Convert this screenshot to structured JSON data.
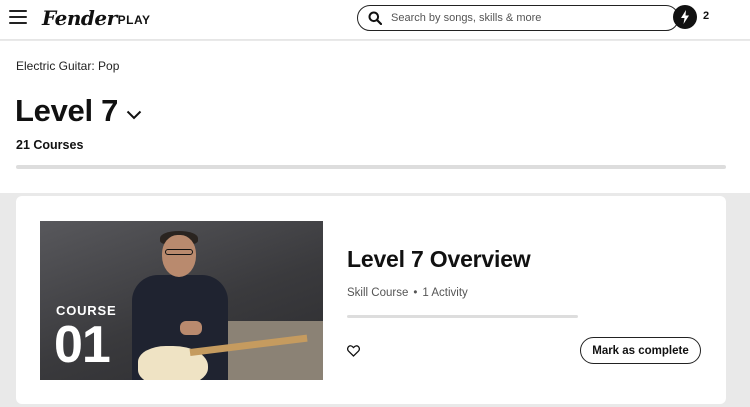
{
  "header": {
    "logo_text": "Fender",
    "logo_suffix": "PLAY",
    "search": {
      "placeholder": "Search by songs, skills & more",
      "icon": "search-icon"
    },
    "streak_count": "2",
    "streak_icon": "lightning-bolt-icon"
  },
  "page": {
    "breadcrumb": "Electric Guitar: Pop",
    "level_title": "Level 7",
    "course_count": "21 Courses"
  },
  "course_card": {
    "thumbnail_label": "COURSE",
    "thumbnail_number": "01",
    "title": "Level 7 Overview",
    "type": "Skill Course",
    "separator": "•",
    "activity": "1 Activity",
    "mark_complete_label": "Mark as complete",
    "favorite_icon": "heart-icon"
  },
  "colors": {
    "accent": "#111111",
    "page_background": "#e9e9e9",
    "progress_track": "#dddddd"
  }
}
